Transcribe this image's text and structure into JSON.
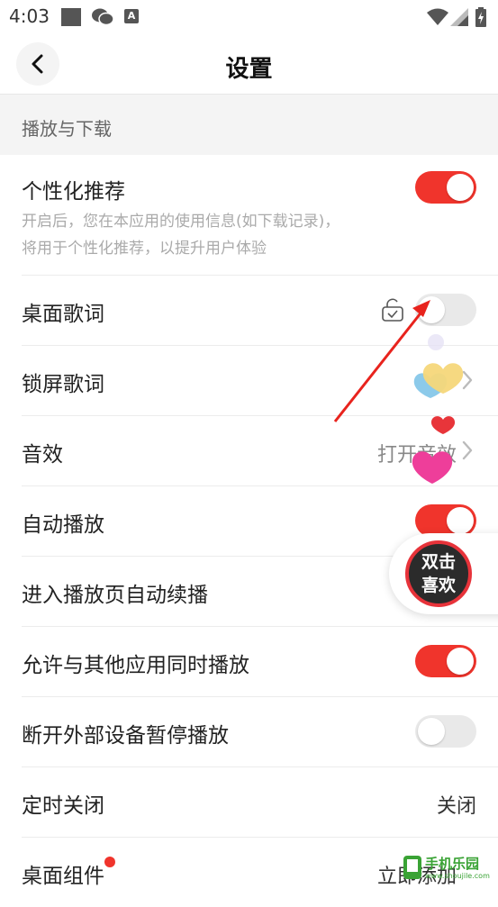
{
  "status_bar": {
    "time": "4:03",
    "app_icon_letter": "A"
  },
  "header": {
    "title": "设置",
    "back_icon": "chevron-left-icon"
  },
  "section": {
    "label": "播放与下载"
  },
  "rows": {
    "personalized": {
      "label": "个性化推荐",
      "desc_line1": "开启后，您在本应用的使用信息(如下载记录)，",
      "desc_line2": "将用于个性化推荐，以提升用户体验",
      "toggle": true
    },
    "desktop_lyrics": {
      "label": "桌面歌词",
      "toggle": false,
      "icon": "lock-open-icon"
    },
    "lockscreen_lyrics": {
      "label": "锁屏歌词"
    },
    "sound_effect": {
      "label": "音效",
      "value": "打开音效"
    },
    "autoplay": {
      "label": "自动播放",
      "toggle": true
    },
    "autoresume": {
      "label": "进入播放页自动续播"
    },
    "mix_play": {
      "label": "允许与其他应用同时播放",
      "toggle": true
    },
    "pause_on_disconnect": {
      "label": "断开外部设备暂停播放",
      "toggle": false
    },
    "timer": {
      "label": "定时关闭",
      "value": "关闭"
    },
    "widget": {
      "label": "桌面组件",
      "value": "立即添加"
    }
  },
  "floating": {
    "line1": "双击",
    "line2": "喜欢"
  },
  "watermark": {
    "text": "手机乐园",
    "sub": "www.shoujile.com"
  },
  "colors": {
    "accent": "#f0342c",
    "section_bg": "#f4f4f4"
  }
}
